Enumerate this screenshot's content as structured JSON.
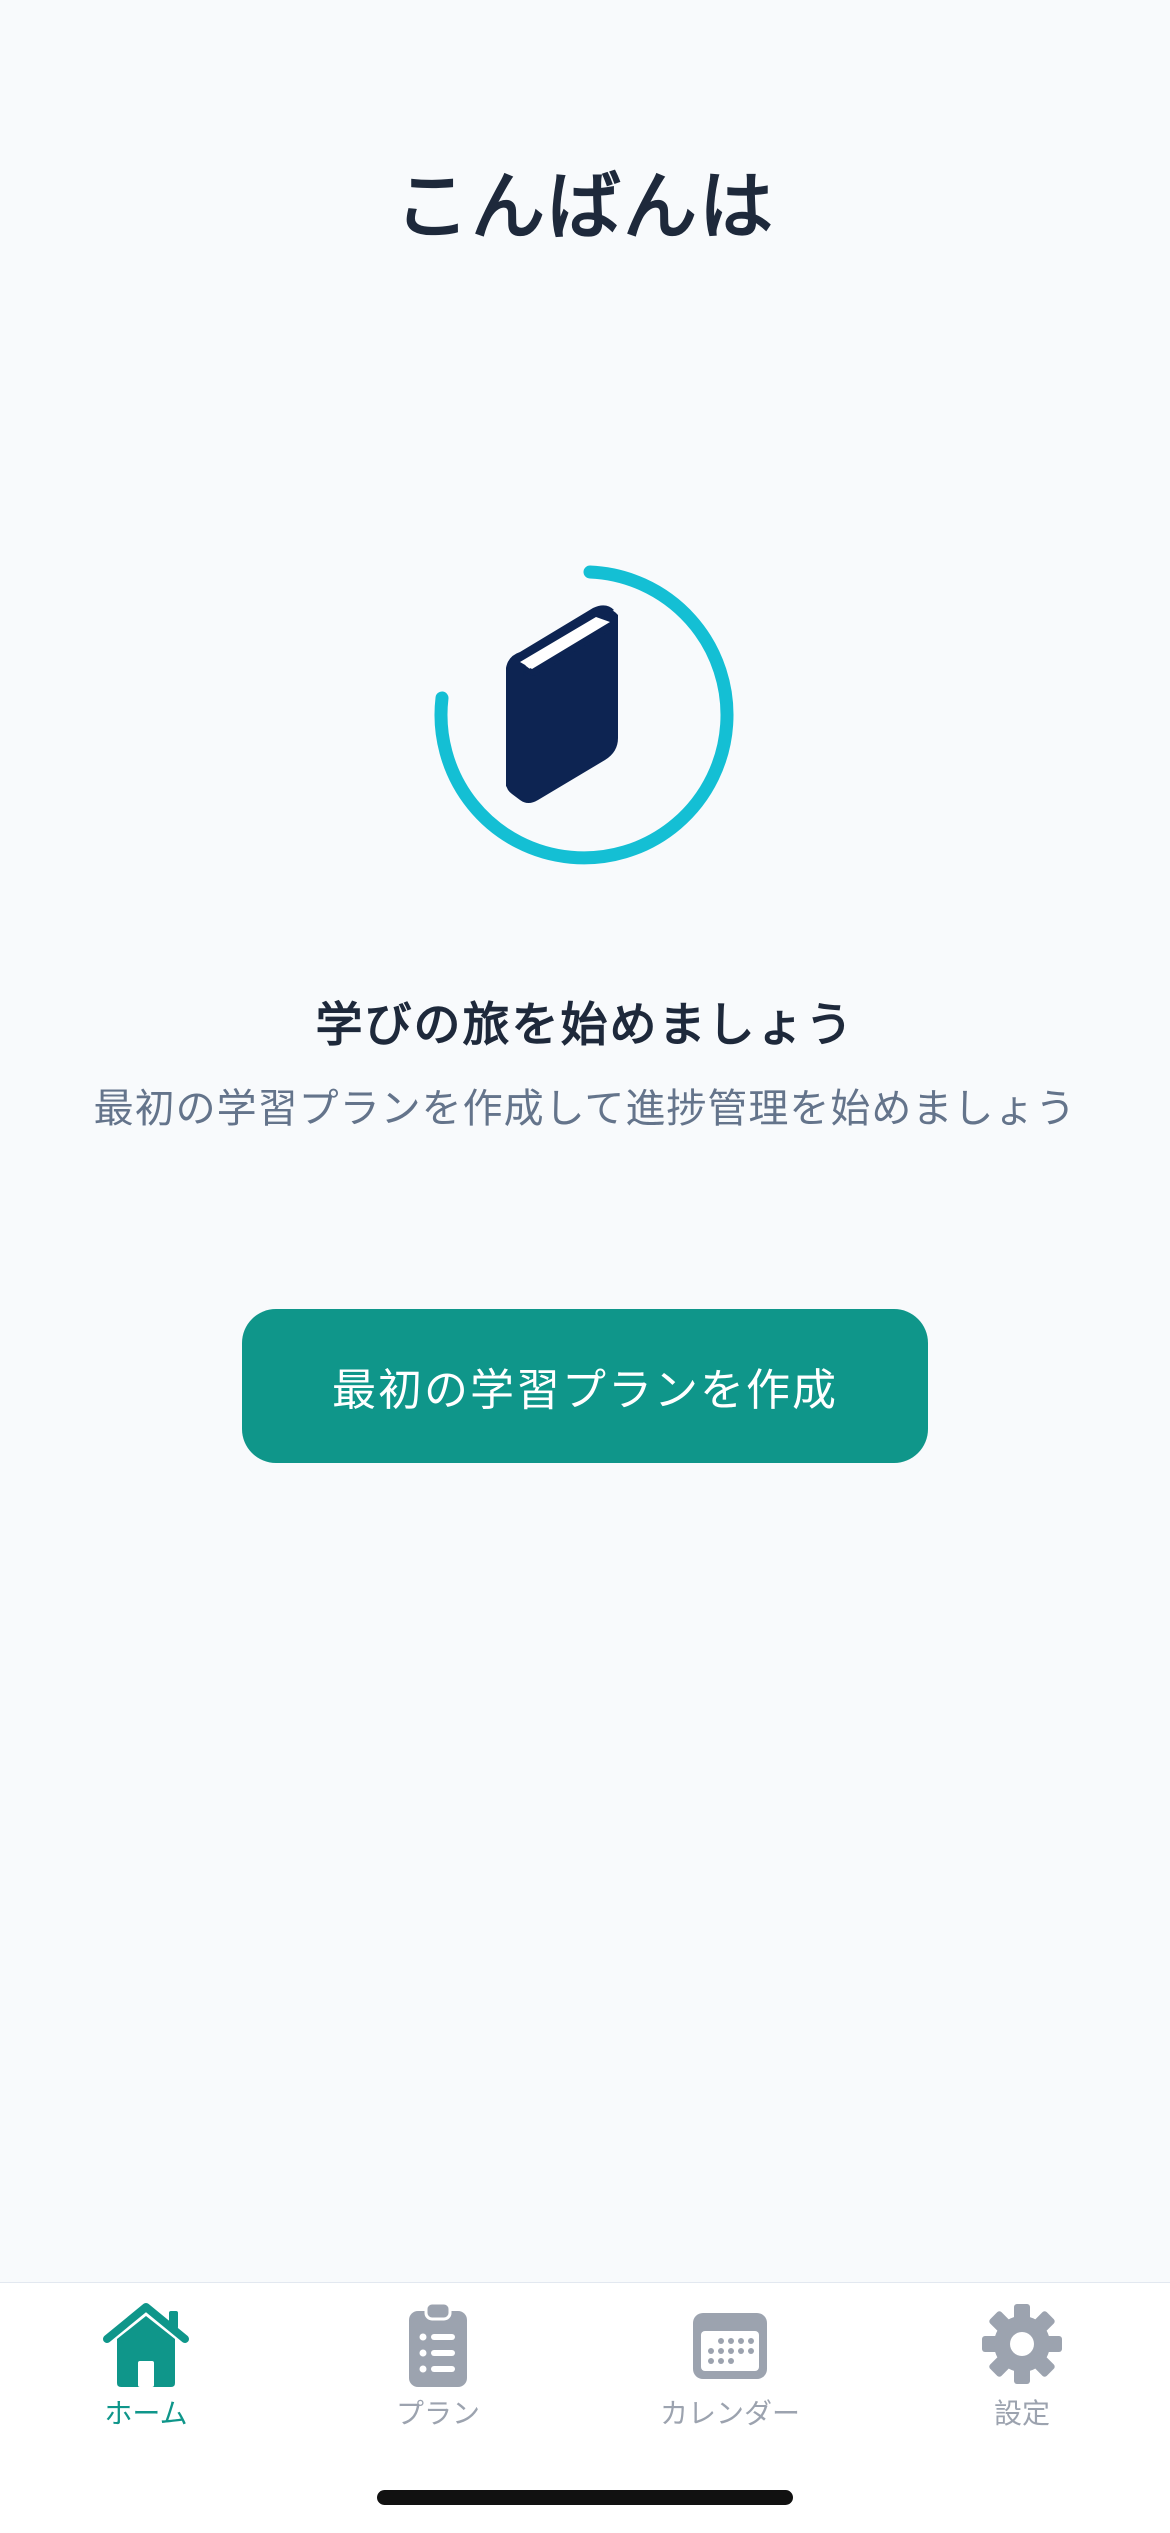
{
  "header": {
    "greeting": "こんばんは"
  },
  "hero": {
    "icon": "book-icon",
    "ring_color": "#14bfd4",
    "book_color": "#0d2452"
  },
  "empty_state": {
    "title": "学びの旅を始めましょう",
    "message": "最初の学習プランを作成して進捗管理を始めましょう"
  },
  "cta": {
    "label": "最初の学習プランを作成",
    "color": "#0f968a"
  },
  "tabbar": {
    "tabs": [
      {
        "label": "ホーム",
        "icon": "home-icon",
        "active": true
      },
      {
        "label": "プラン",
        "icon": "clipboard-list-icon",
        "active": false
      },
      {
        "label": "カレンダー",
        "icon": "calendar-icon",
        "active": false
      },
      {
        "label": "設定",
        "icon": "gear-icon",
        "active": false
      }
    ],
    "active_color": "#0f968a",
    "inactive_color": "#9ca3af"
  }
}
